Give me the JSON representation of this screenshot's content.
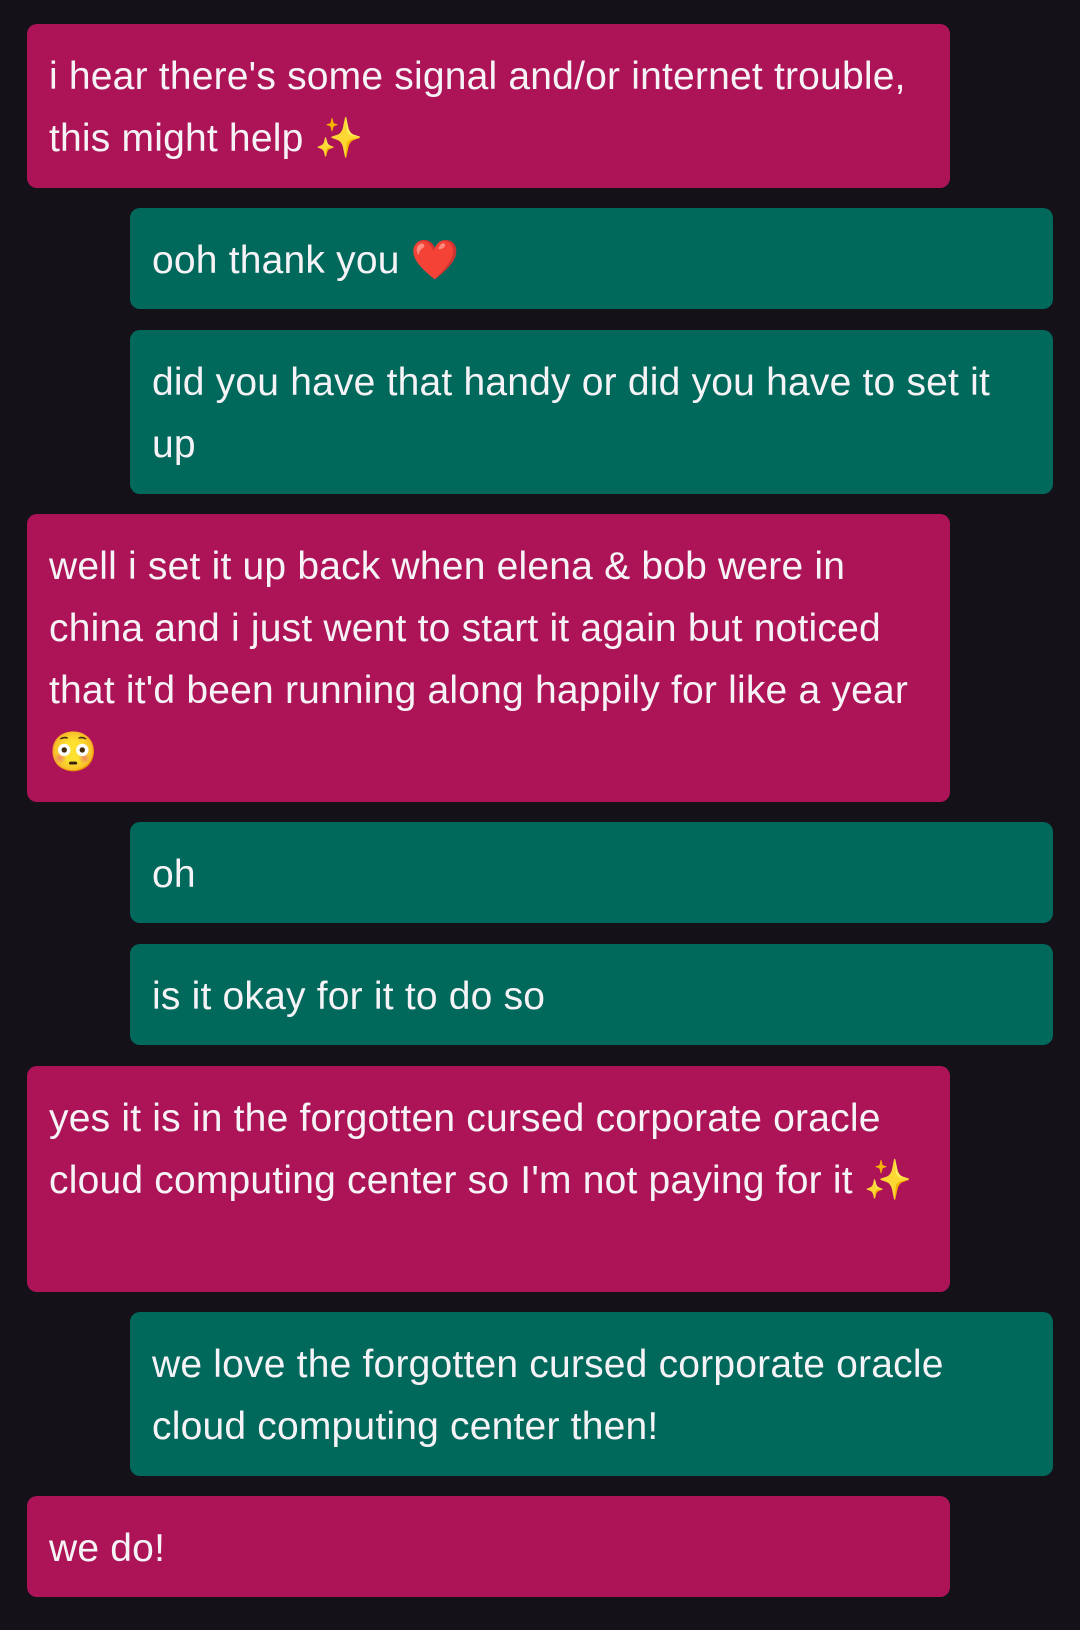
{
  "colors": {
    "background": "#141218",
    "incoming_bubble": "#ad1457",
    "outgoing_bubble": "#00695c",
    "text": "#f6f3f7"
  },
  "messages": [
    {
      "direction": "incoming",
      "text": "i hear there's some signal and/or internet trouble, this might help ✨"
    },
    {
      "direction": "outgoing",
      "text": "ooh thank you ❤️"
    },
    {
      "direction": "outgoing",
      "text": "did you have that handy or did you have to set it up"
    },
    {
      "direction": "incoming",
      "text": "well i set it up back when elena & bob were in china and i just went to start it again but noticed that it'd been running along happily for like a year 😳"
    },
    {
      "direction": "outgoing",
      "text": "oh"
    },
    {
      "direction": "outgoing",
      "text": "is it okay for it to do so"
    },
    {
      "direction": "incoming",
      "text": "yes it is in the forgotten cursed corporate oracle cloud computing center so I'm not paying for it ✨"
    },
    {
      "direction": "outgoing",
      "text": "we love the forgotten cursed corporate oracle cloud computing center then!"
    },
    {
      "direction": "incoming",
      "text": "we do!"
    }
  ]
}
